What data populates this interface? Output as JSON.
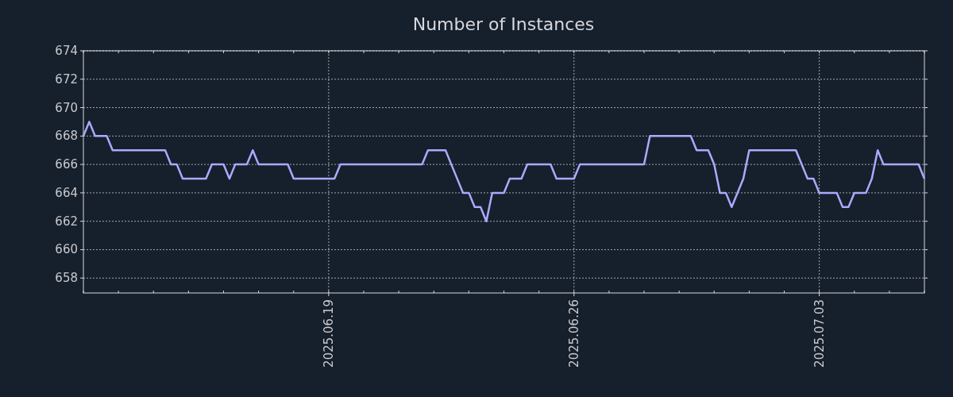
{
  "chart_data": {
    "type": "line",
    "title": "Number of Instances",
    "x": [
      "2025-06-12T00:00",
      "2025-06-12T04:00",
      "2025-06-12T08:00",
      "2025-06-12T16:00",
      "2025-06-12T20:00",
      "2025-06-14T08:00",
      "2025-06-14T12:00",
      "2025-06-14T16:00",
      "2025-06-14T20:00",
      "2025-06-15T12:00",
      "2025-06-15T16:00",
      "2025-06-16T00:00",
      "2025-06-16T04:00",
      "2025-06-16T08:00",
      "2025-06-16T16:00",
      "2025-06-16T20:00",
      "2025-06-17T00:00",
      "2025-06-17T20:00",
      "2025-06-18T00:00",
      "2025-06-19T04:00",
      "2025-06-19T08:00",
      "2025-06-21T16:00",
      "2025-06-21T20:00",
      "2025-06-22T08:00",
      "2025-06-22T12:00",
      "2025-06-22T20:00",
      "2025-06-23T00:00",
      "2025-06-23T04:00",
      "2025-06-23T08:00",
      "2025-06-23T12:00",
      "2025-06-23T16:00",
      "2025-06-24T00:00",
      "2025-06-24T04:00",
      "2025-06-24T12:00",
      "2025-06-24T16:00",
      "2025-06-25T08:00",
      "2025-06-25T12:00",
      "2025-06-26T00:00",
      "2025-06-26T04:00",
      "2025-06-28T00:00",
      "2025-06-28T04:00",
      "2025-06-29T08:00",
      "2025-06-29T12:00",
      "2025-06-29T20:00",
      "2025-06-30T00:00",
      "2025-06-30T04:00",
      "2025-06-30T08:00",
      "2025-06-30T12:00",
      "2025-06-30T20:00",
      "2025-07-01T00:00",
      "2025-07-02T08:00",
      "2025-07-02T16:00",
      "2025-07-02T20:00",
      "2025-07-03T00:00",
      "2025-07-03T12:00",
      "2025-07-03T16:00",
      "2025-07-03T20:00",
      "2025-07-04T00:00",
      "2025-07-04T08:00",
      "2025-07-04T12:00",
      "2025-07-04T16:00",
      "2025-07-04T20:00",
      "2025-07-05T20:00",
      "2025-07-06T00:00"
    ],
    "series": [
      {
        "color": "#aaaaff",
        "values": [
          668,
          669,
          668,
          668,
          667,
          667,
          666,
          666,
          665,
          665,
          666,
          666,
          665,
          666,
          666,
          667,
          666,
          666,
          665,
          665,
          666,
          666,
          667,
          667,
          666,
          664,
          664,
          663,
          663,
          662,
          664,
          664,
          665,
          665,
          666,
          666,
          665,
          665,
          666,
          666,
          668,
          668,
          667,
          667,
          666,
          664,
          664,
          663,
          665,
          667,
          667,
          665,
          665,
          664,
          664,
          663,
          663,
          664,
          664,
          665,
          667,
          666,
          666,
          665
        ]
      }
    ],
    "xlim": [
      "2025-06-12T00:00",
      "2025-07-06T00:00"
    ],
    "ylim": [
      656.95,
      674
    ],
    "grid": true,
    "xticks": [
      {
        "value": "2025-06-19T00:00",
        "label": "2025.06.19"
      },
      {
        "value": "2025-06-26T00:00",
        "label": "2025.06.26"
      },
      {
        "value": "2025-07-03T00:00",
        "label": "2025.07.03"
      }
    ],
    "yticks": [
      658,
      660,
      662,
      664,
      666,
      668,
      670,
      672,
      674
    ]
  }
}
